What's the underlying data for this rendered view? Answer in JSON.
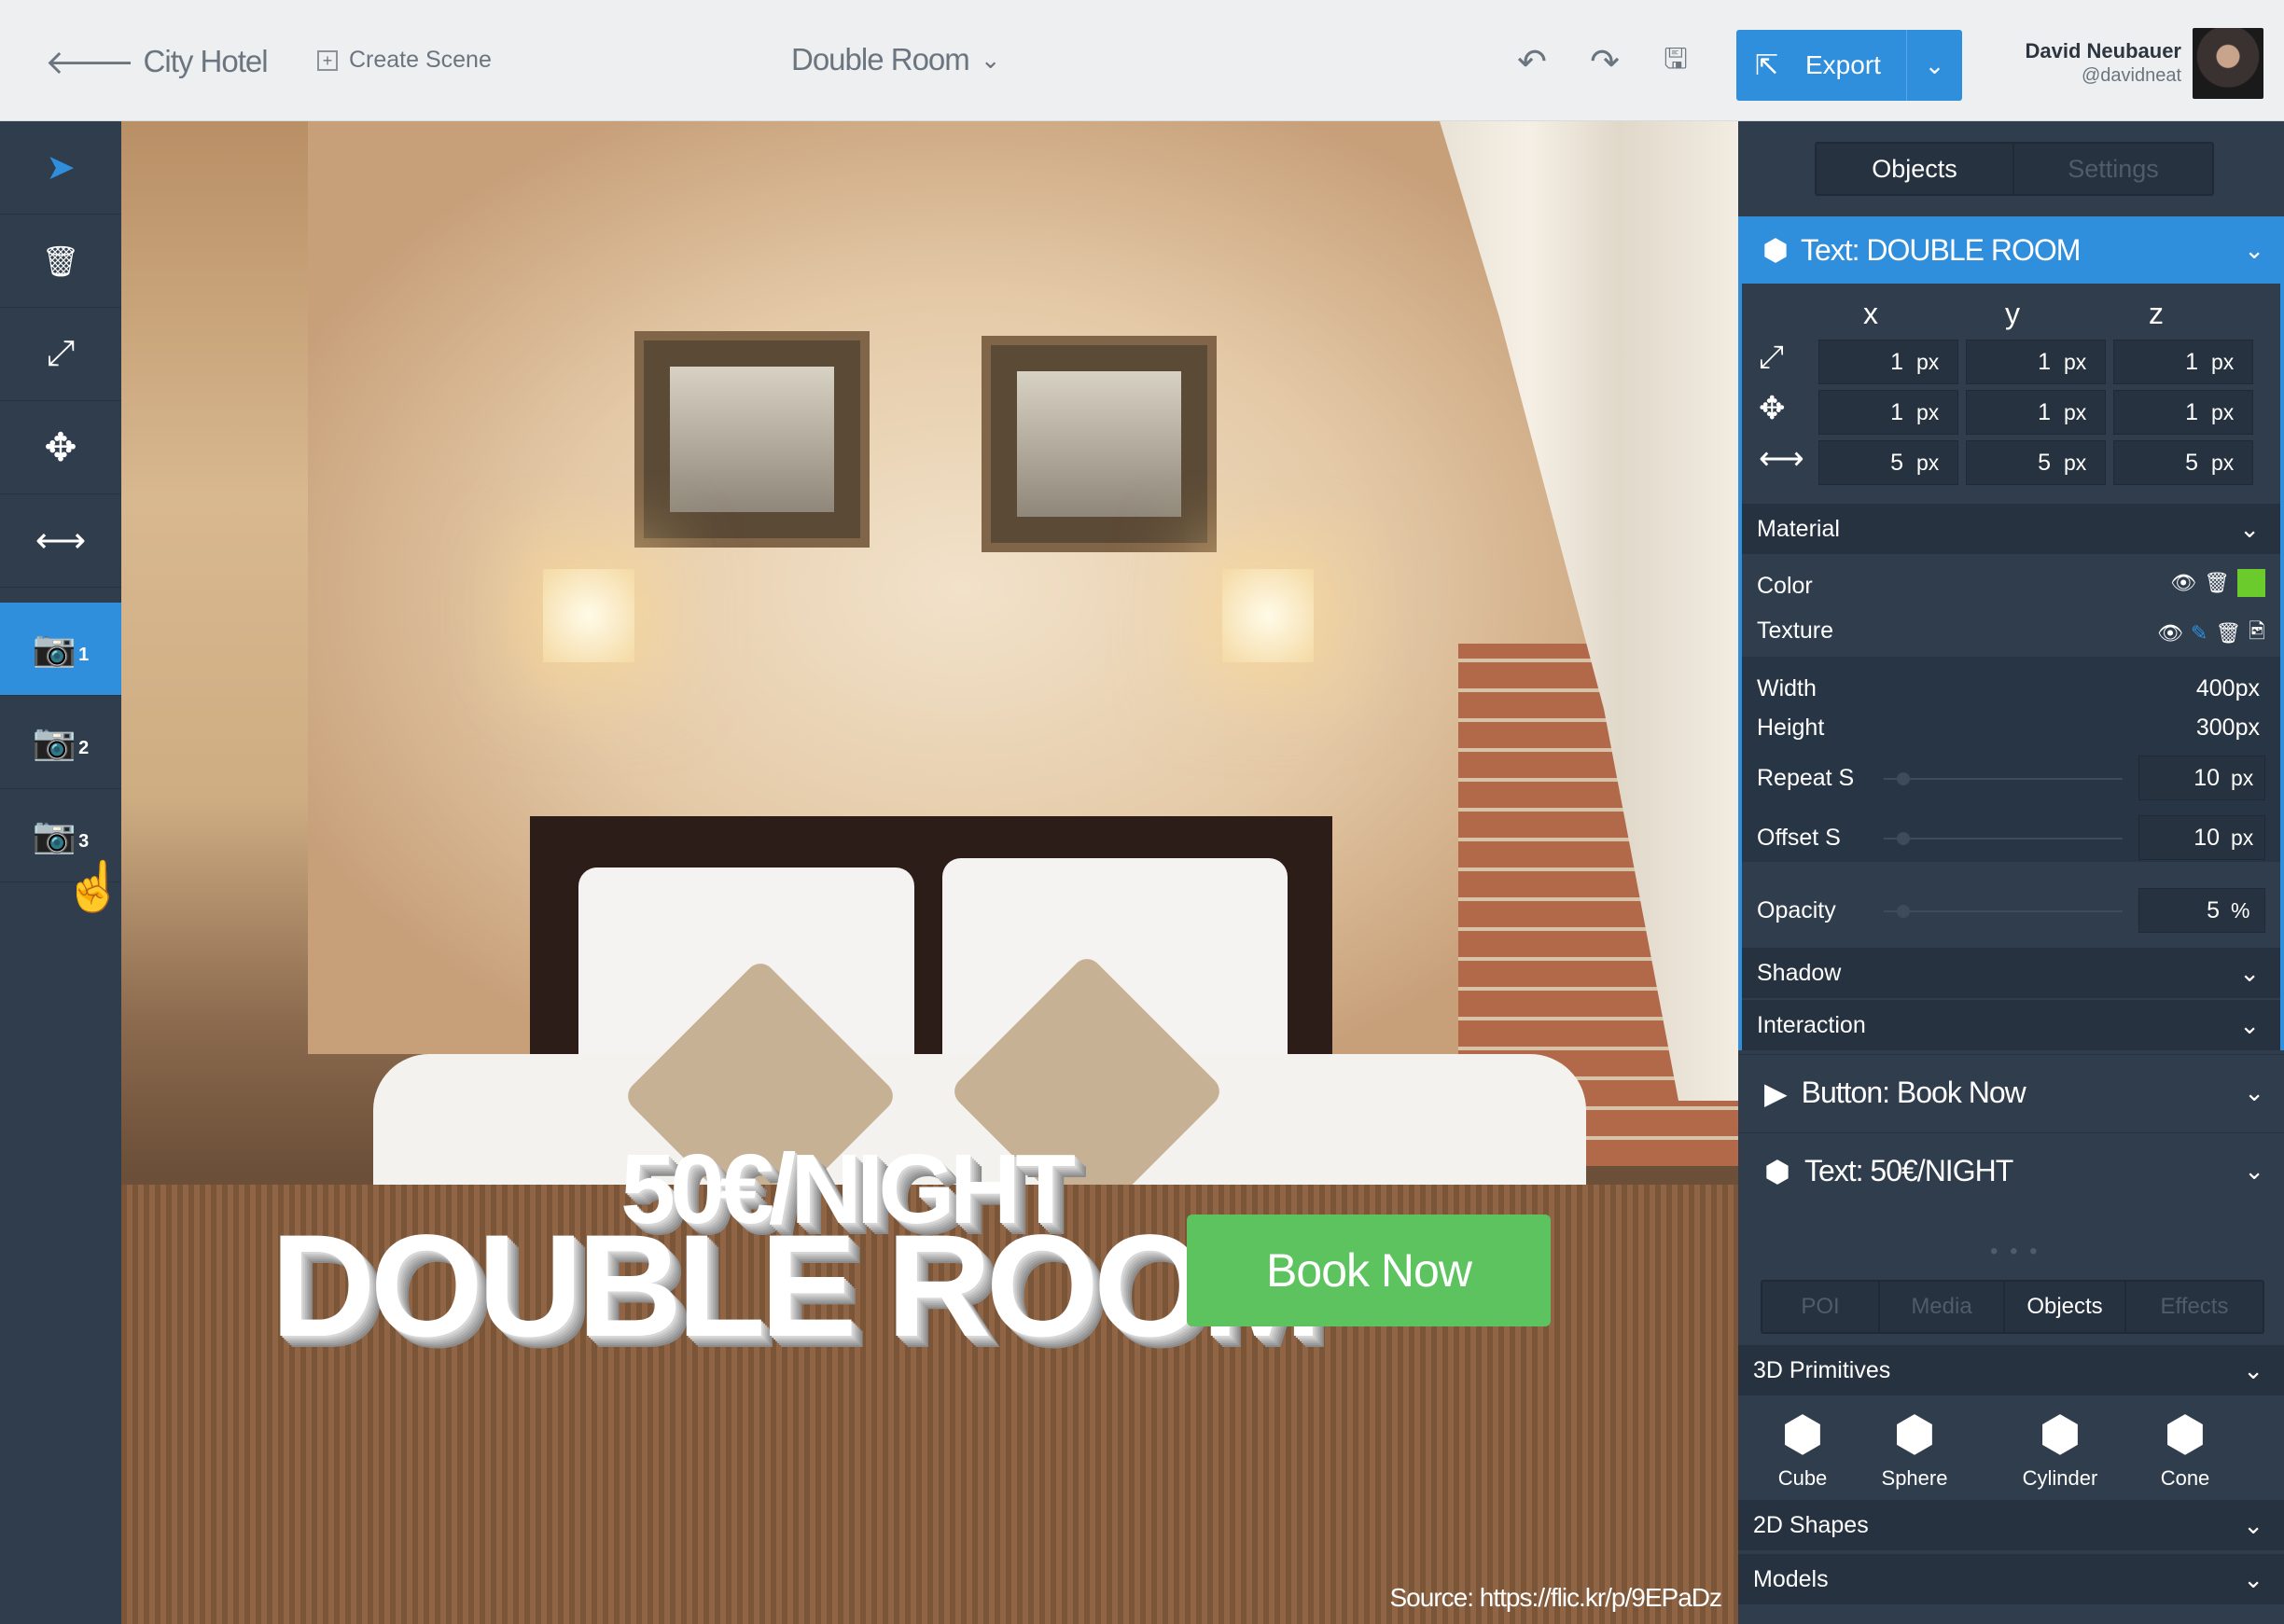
{
  "topbar": {
    "back_label": "City Hotel",
    "create_label": "Create Scene",
    "scene_title": "Double Room",
    "export_label": "Export",
    "user_name": "David Neubauer",
    "user_handle": "@davidneat",
    "accent": "#2f8fdc"
  },
  "leftbar": {
    "items": [
      {
        "icon": "navigate-icon"
      },
      {
        "icon": "trash-icon"
      },
      {
        "icon": "scale-icon"
      },
      {
        "icon": "move-icon"
      },
      {
        "icon": "stretch-icon"
      },
      {
        "icon": "camera-icon",
        "badge": "1",
        "active": true
      },
      {
        "icon": "camera-icon",
        "badge": "2"
      },
      {
        "icon": "camera-icon",
        "badge": "3"
      }
    ]
  },
  "viewport": {
    "text_night": "50€/NIGHT",
    "text_room": "DOUBLE ROOM",
    "book_button": "Book Now",
    "source": "Source:  https://flic.kr/p/9EPaDz"
  },
  "panel": {
    "tabs": [
      "Objects",
      "Settings"
    ],
    "selected_object": "Text:  DOUBLE ROOM",
    "axes": [
      "x",
      "y",
      "z"
    ],
    "transform": {
      "scale": {
        "x": "1",
        "y": "1",
        "z": "1"
      },
      "position": {
        "x": "1",
        "y": "1",
        "z": "1"
      },
      "stretch": {
        "x": "5",
        "y": "5",
        "z": "5"
      },
      "unit": "px"
    },
    "material": {
      "title": "Material",
      "color_label": "Color",
      "color_value": "#6ccb2c",
      "texture_label": "Texture",
      "width_label": "Width",
      "width_value": "400px",
      "height_label": "Height",
      "height_value": "300px",
      "repeat_label": "Repeat S",
      "repeat_value": "10",
      "offset_label": "Offset S",
      "offset_value": "10",
      "opacity_label": "Opacity",
      "opacity_value": "5",
      "px": "px",
      "percent": "%"
    },
    "shadow_label": "Shadow",
    "interaction_label": "Interaction",
    "other_objects": [
      "Button:  Book Now",
      "Text:  50€/NIGHT"
    ],
    "bottom_tabs": [
      "POI",
      "Media",
      "Objects",
      "Effects"
    ],
    "primitives_title": "3D Primitives",
    "primitives": [
      "Cube",
      "Sphere",
      "Cylinder",
      "Cone"
    ],
    "shapes_title": "2D Shapes",
    "models_title": "Models"
  }
}
